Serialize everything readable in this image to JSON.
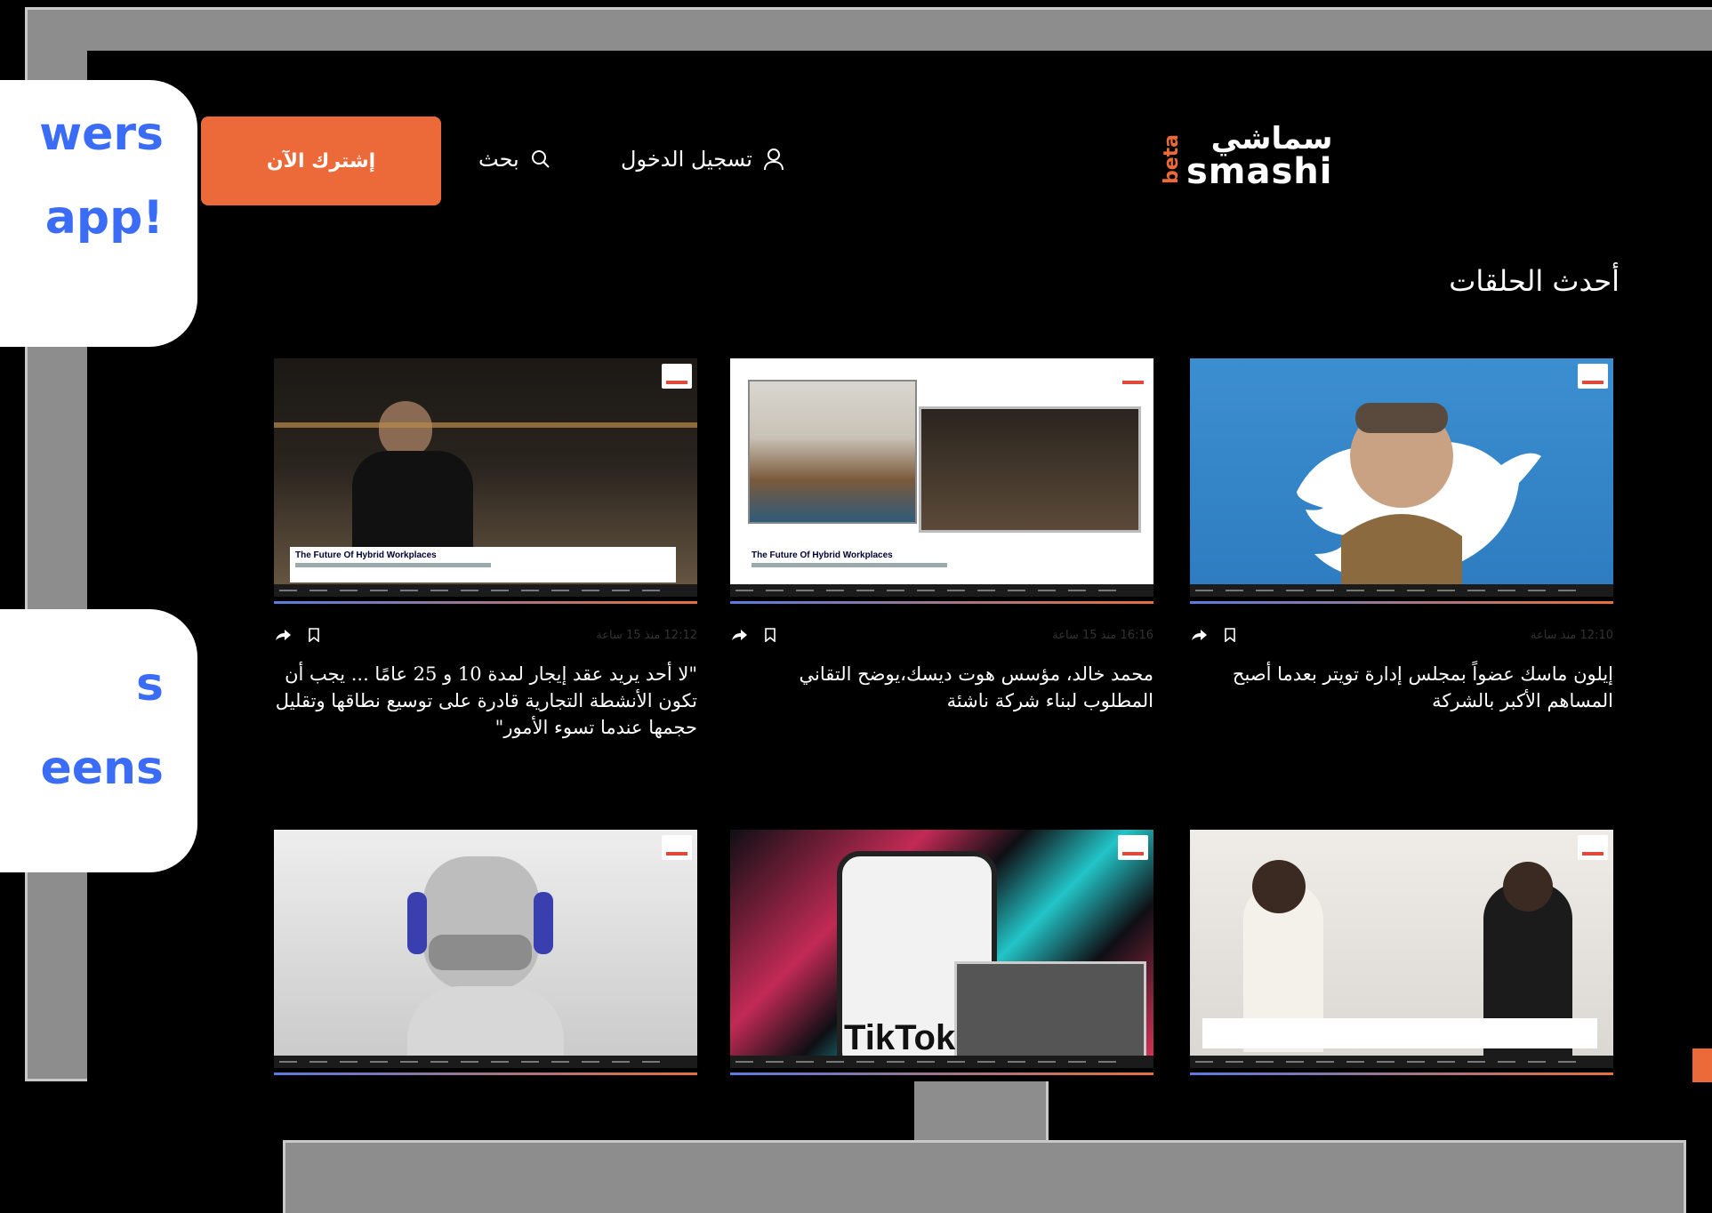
{
  "bubbles": [
    {
      "line1": "wers",
      "line2": "app!"
    },
    {
      "line1": "s",
      "line2": "eens"
    }
  ],
  "header": {
    "logo_beta": "beta",
    "logo_arabic": "سماشي",
    "logo_latin": "smashi",
    "login_label": "تسجيل الدخول",
    "search_label": "بحث",
    "subscribe_label": "إشترك الآن"
  },
  "section_title": "أحدث الحلقات",
  "episodes": [
    {
      "title": "إيلون ماسك عضواً بمجلس إدارة تويتر بعدما أصبح المساهم الأكبر بالشركة",
      "time": "12:10 منذ ساعة",
      "thumb_colors": [
        "#3b8fd1",
        "#2e7bc0"
      ]
    },
    {
      "title": "محمد خالد، مؤسس هوت ديسك،يوضح التقاني المطلوب لبناء شركة ناشئة",
      "time": "16:16 منذ 15 ساعة",
      "thumb_caption": "The Future Of Hybrid Workplaces",
      "thumb_colors": [
        "#d9d6cf",
        "#a68a62"
      ]
    },
    {
      "title": "\"لا أحد يريد عقد إيجار لمدة 10 و 25 عامًا ... يجب أن تكون الأنشطة التجارية قادرة على توسيع نطاقها وتقليل حجمها عندما تسوء الأمور\"",
      "time": "12:12 منذ 15 ساعة",
      "thumb_caption": "The Future Of Hybrid Workplaces",
      "thumb_colors": [
        "#2a241e",
        "#6b5a44"
      ]
    },
    {
      "title": "",
      "time": "",
      "thumb_colors": [
        "#c9c9c9",
        "#eeeeee"
      ]
    },
    {
      "title": "",
      "time": "",
      "thumb_caption": "TikTok",
      "thumb_colors": [
        "#0f0f14",
        "#e2365b"
      ]
    },
    {
      "title": "",
      "time": "",
      "thumb_colors": [
        "#dad7d2",
        "#efece7"
      ]
    }
  ],
  "colors": {
    "accent": "#ec6a3a",
    "bubble_text": "#3b6cf6",
    "frame": "#8d8d8d"
  }
}
